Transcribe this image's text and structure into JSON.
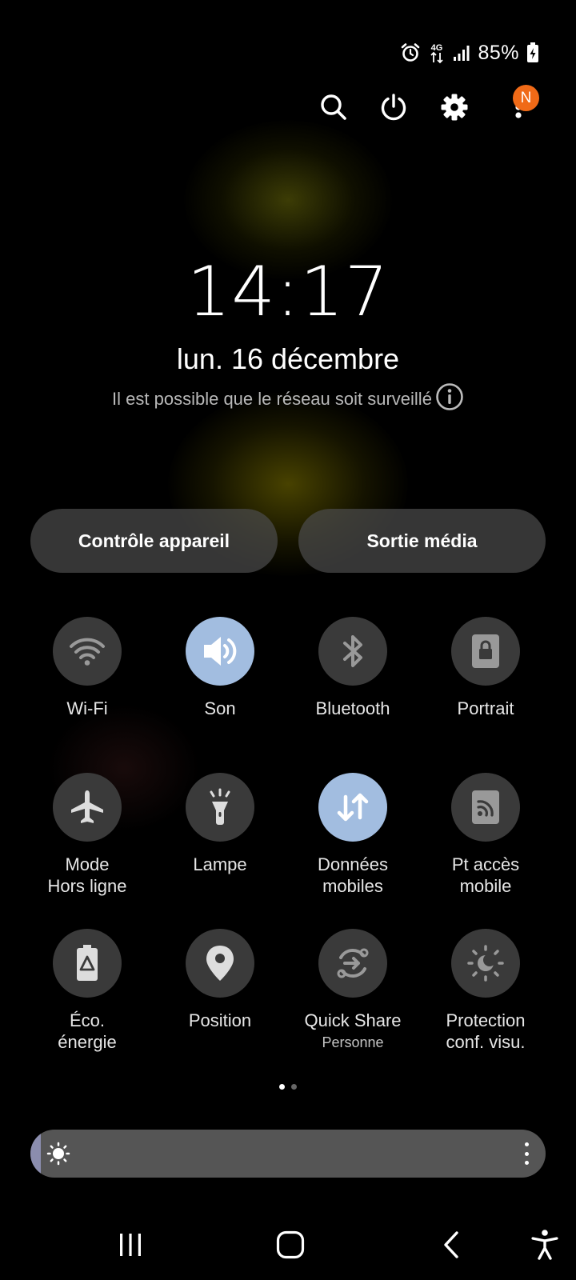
{
  "status_bar": {
    "battery_percent": "85%",
    "network": "4G",
    "icons": [
      "alarm-icon",
      "4g-data-icon",
      "signal-icon",
      "battery-charging-icon"
    ]
  },
  "top_actions": {
    "notification_badge": "N",
    "icons": [
      "search-icon",
      "power-icon",
      "gear-icon",
      "more-vert-icon"
    ]
  },
  "clock": {
    "time": "14:17",
    "date": "lun. 16 décembre",
    "network_notice": "Il est possible que le réseau soit surveillé"
  },
  "buttons": {
    "device_control": "Contrôle appareil",
    "media_output": "Sortie média"
  },
  "tiles": [
    {
      "label": "Wi-Fi",
      "icon": "wifi-icon",
      "active": false
    },
    {
      "label": "Son",
      "icon": "sound-icon",
      "active": true
    },
    {
      "label": "Bluetooth",
      "icon": "bluetooth-icon",
      "active": false
    },
    {
      "label": "Portrait",
      "icon": "rotation-lock-icon",
      "active": false
    },
    {
      "label_line1": "Mode",
      "label_line2": "Hors ligne",
      "icon": "airplane-icon",
      "active": false
    },
    {
      "label": "Lampe",
      "icon": "flashlight-icon",
      "active": false
    },
    {
      "label_line1": "Données",
      "label_line2": "mobiles",
      "icon": "mobile-data-icon",
      "active": true
    },
    {
      "label_line1": "Pt accès",
      "label_line2": "mobile",
      "icon": "hotspot-icon",
      "active": false
    },
    {
      "label_line1": "Éco.",
      "label_line2": "énergie",
      "icon": "power-saving-icon",
      "active": false
    },
    {
      "label": "Position",
      "icon": "location-icon",
      "active": false
    },
    {
      "label": "Quick Share",
      "sublabel": "Personne",
      "icon": "quick-share-icon",
      "active": false
    },
    {
      "label_line1": "Protection",
      "label_line2": "conf. visu.",
      "icon": "eye-comfort-icon",
      "active": false
    }
  ],
  "page_indicator": {
    "pages": 2,
    "current": 1
  },
  "brightness": {
    "level_fraction": 0.02
  },
  "nav_bar": {
    "icons": [
      "recents-icon",
      "home-icon",
      "back-icon",
      "accessibility-icon"
    ]
  },
  "colors": {
    "active_tile": "#a2bde0",
    "inactive_tile": "#3a3a3a",
    "badge": "#f06a17",
    "brightness_fill": "#8b8dae"
  }
}
